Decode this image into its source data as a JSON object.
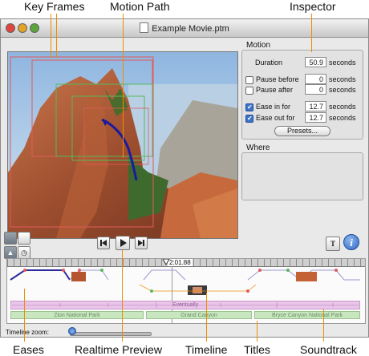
{
  "callouts": {
    "key_frames": "Key Frames",
    "motion_path": "Motion Path",
    "inspector": "Inspector",
    "eases": "Eases",
    "realtime_preview": "Realtime Preview",
    "timeline": "Timeline",
    "titles": "Titles",
    "soundtrack": "Soundtrack"
  },
  "window": {
    "title": "Example Movie.ptm"
  },
  "inspector": {
    "motion_header": "Motion",
    "duration_label": "Duration",
    "duration_value": "50.9",
    "pause_before_label": "Pause before",
    "pause_before_value": "0",
    "pause_after_label": "Pause after",
    "pause_after_value": "0",
    "ease_in_label": "Ease in for",
    "ease_in_value": "12.7",
    "ease_out_label": "Ease out for",
    "ease_out_value": "12.7",
    "units": "seconds",
    "presets_button": "Presets...",
    "where_header": "Where"
  },
  "toolbar": {
    "text_button": "T",
    "info_button": "i"
  },
  "timeline": {
    "playhead_time": "2:01.88",
    "soundtrack_label": "Eventually",
    "titles": [
      "Zion National Park",
      "Grand Canyon",
      "Bryce Canyon National Park"
    ],
    "zoom_label": "Timeline zoom:"
  },
  "colors": {
    "callout_line": "#f08c00",
    "motion_path": "#1a1a9e",
    "ease_line": "#2a2a9a",
    "soundtrack": "#e9c6e9",
    "titles": "#c8e6c0",
    "info_button": "#2f66c4"
  }
}
